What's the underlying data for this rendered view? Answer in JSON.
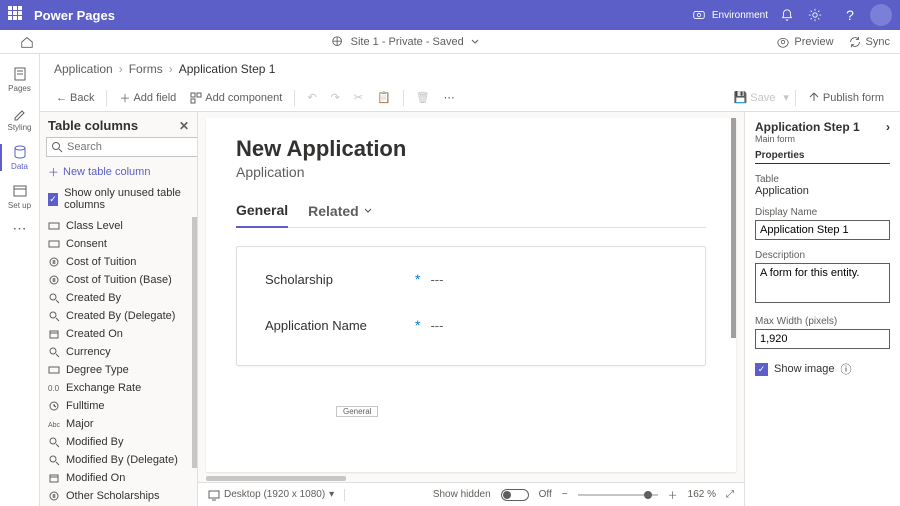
{
  "topbar": {
    "brand": "Power Pages",
    "env_label": "Environment"
  },
  "subhead": {
    "site": "Site 1 - Private - Saved",
    "preview": "Preview",
    "sync": "Sync"
  },
  "rail": {
    "items": [
      "Pages",
      "Styling",
      "Data",
      "Set up"
    ]
  },
  "breadcrumb": {
    "a": "Application",
    "b": "Forms",
    "c": "Application Step 1"
  },
  "toolbar": {
    "back": "Back",
    "add_field": "Add field",
    "add_component": "Add component",
    "save": "Save",
    "publish": "Publish form"
  },
  "tcols": {
    "title": "Table columns",
    "search_ph": "Search",
    "newcol": "New table column",
    "unused": "Show only unused table columns",
    "list": [
      "Class Level",
      "Consent",
      "Cost of Tuition",
      "Cost of Tuition (Base)",
      "Created By",
      "Created By (Delegate)",
      "Created On",
      "Currency",
      "Degree Type",
      "Exchange Rate",
      "Fulltime",
      "Major",
      "Modified By",
      "Modified By (Delegate)",
      "Modified On",
      "Other Scholarships"
    ]
  },
  "canvas": {
    "title": "New Application",
    "subtitle": "Application",
    "tabs": {
      "general": "General",
      "related": "Related"
    },
    "fields": [
      {
        "label": "Scholarship",
        "value": "---"
      },
      {
        "label": "Application Name",
        "value": "---"
      }
    ],
    "chip": "General"
  },
  "status": {
    "device": "Desktop (1920 x 1080)",
    "show_hidden": "Show hidden",
    "off": "Off",
    "zoom": "162 %"
  },
  "props": {
    "title": "Application Step 1",
    "sub": "Main form",
    "section": "Properties",
    "table_lbl": "Table",
    "table_val": "Application",
    "display_lbl": "Display Name",
    "display_val": "Application Step 1",
    "desc_lbl": "Description",
    "desc_val": "A form for this entity.",
    "max_lbl": "Max Width (pixels)",
    "max_val": "1,920",
    "show_image": "Show image"
  }
}
